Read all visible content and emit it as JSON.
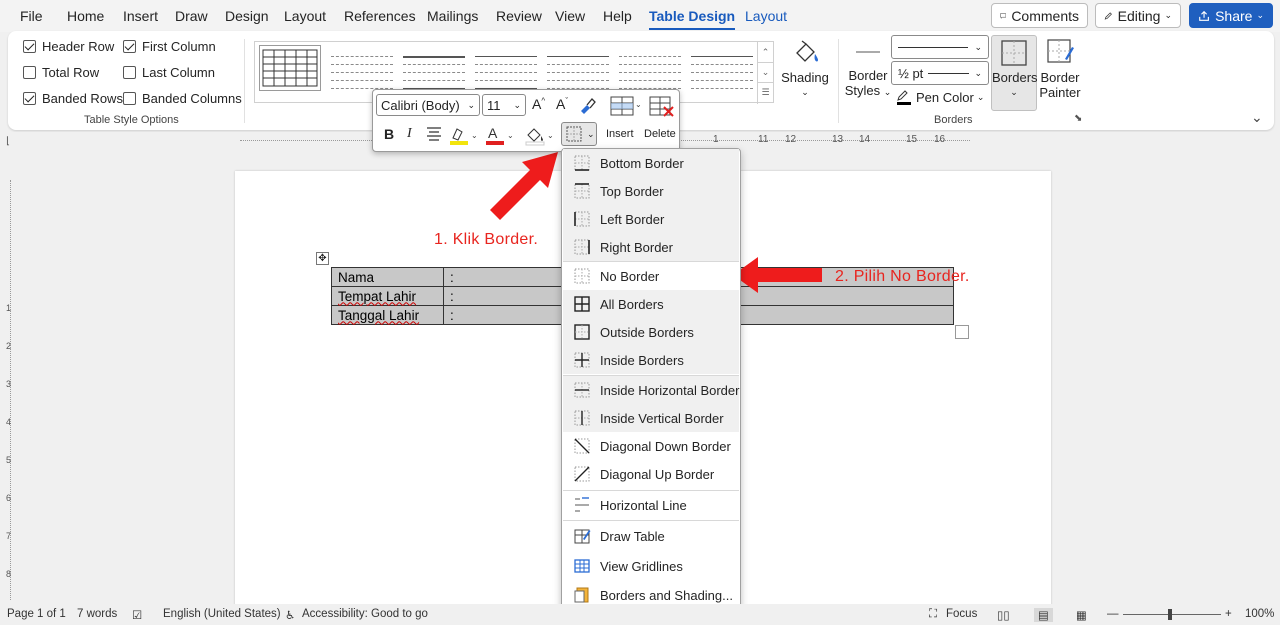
{
  "menu": {
    "tabs": [
      "File",
      "Home",
      "Insert",
      "Draw",
      "Design",
      "Layout",
      "References",
      "Mailings",
      "Review",
      "View",
      "Help",
      "Table Design",
      "Layout"
    ],
    "comments_label": "Comments",
    "editing_label": "Editing",
    "share_label": "Share"
  },
  "ribbon": {
    "options": {
      "header_row": "Header Row",
      "first_column": "First Column",
      "total_row": "Total Row",
      "last_column": "Last Column",
      "banded_rows": "Banded Rows",
      "banded_columns": "Banded Columns",
      "group_label": "Table Style Options"
    },
    "shading_label": "Shading",
    "border_styles_label1": "Border",
    "border_styles_label2": "Styles",
    "pen_weight": "½ pt",
    "pen_color_label": "Pen Color",
    "borders_label": "Borders",
    "border_painter_label1": "Border",
    "border_painter_label2": "Painter",
    "borders_group_label": "Borders"
  },
  "mini_toolbar": {
    "font": "Calibri (Body)",
    "size": "11",
    "bold": "B",
    "italic": "I",
    "insert_label": "Insert",
    "delete_label": "Delete"
  },
  "ruler_labels": [
    "1",
    "11",
    "12",
    "13",
    "14",
    "15",
    "16"
  ],
  "vruler_labels": [
    "1",
    "2",
    "3",
    "4",
    "5",
    "6",
    "7",
    "8"
  ],
  "table": {
    "rows": [
      {
        "label": "Nama",
        "colon": ":"
      },
      {
        "label": "Tempat Lahir",
        "colon": ":"
      },
      {
        "label": "Tanggal Lahir",
        "colon": ":"
      }
    ]
  },
  "annotations": {
    "step1": "1. Klik Border.",
    "step2": "2. Pilih No Border."
  },
  "borders_menu": [
    "Bottom Border",
    "Top Border",
    "Left Border",
    "Right Border",
    "No Border",
    "All Borders",
    "Outside Borders",
    "Inside Borders",
    "Inside Horizontal Border",
    "Inside Vertical Border",
    "Diagonal Down Border",
    "Diagonal Up Border",
    "Horizontal Line",
    "Draw Table",
    "View Gridlines",
    "Borders and Shading..."
  ],
  "status": {
    "page": "Page 1 of 1",
    "words": "7 words",
    "language": "English (United States)",
    "accessibility": "Accessibility: Good to go",
    "focus": "Focus",
    "zoom": "100%"
  },
  "colors": {
    "accent": "#185abd",
    "annotation": "#e8251f",
    "table_shade": "#c8c8c8"
  }
}
